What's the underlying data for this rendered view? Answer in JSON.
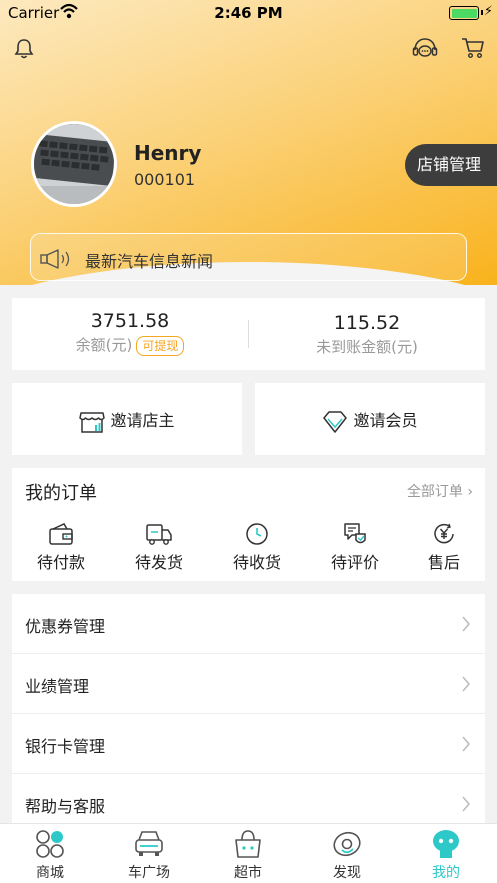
{
  "status_bar": {
    "carrier": "Carrier",
    "time": "2:46 PM"
  },
  "header": {
    "icons": [
      "bell-icon",
      "support-icon",
      "cart-icon"
    ]
  },
  "profile": {
    "name": "Henry",
    "id": "000101",
    "shop_button": "店铺管理"
  },
  "news": {
    "text": "最新汽车信息新闻",
    "icon": "megaphone-icon"
  },
  "balance": {
    "amount": "3751.58",
    "amount_label": "余额(元)",
    "withdraw_tag": "可提现",
    "pending": "115.52",
    "pending_label": "未到账金额(元)"
  },
  "invites": {
    "shopkeeper": "邀请店主",
    "member": "邀请会员"
  },
  "orders": {
    "title": "我的订单",
    "all_label": "全部订单",
    "items": [
      "待付款",
      "待发货",
      "待收货",
      "待评价",
      "售后"
    ]
  },
  "menu": {
    "items": [
      "优惠券管理",
      "业绩管理",
      "银行卡管理",
      "帮助与客服"
    ]
  },
  "tabbar": {
    "items": [
      "商城",
      "车广场",
      "超市",
      "发现",
      "我的"
    ],
    "active_index": 4
  },
  "colors": {
    "accent": "#f9b21c",
    "tab_active": "#2cc9c8",
    "withdraw": "#f5a623",
    "shop_button_bg": "#3d3d3d"
  }
}
